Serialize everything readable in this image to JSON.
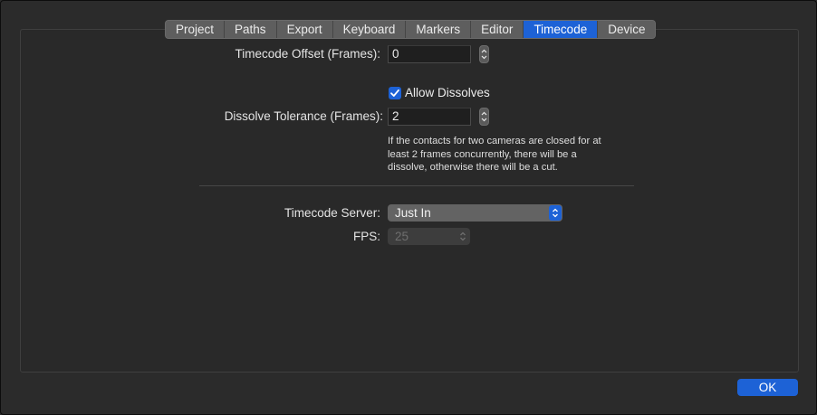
{
  "tabs": [
    {
      "label": "Project",
      "active": false
    },
    {
      "label": "Paths",
      "active": false
    },
    {
      "label": "Export",
      "active": false
    },
    {
      "label": "Keyboard",
      "active": false
    },
    {
      "label": "Markers",
      "active": false
    },
    {
      "label": "Editor",
      "active": false
    },
    {
      "label": "Timecode",
      "active": true
    },
    {
      "label": "Device",
      "active": false
    }
  ],
  "timecode_offset": {
    "label": "Timecode Offset (Frames):",
    "value": "0"
  },
  "allow_dissolves": {
    "label": "Allow Dissolves",
    "checked": true
  },
  "dissolve_tolerance": {
    "label": "Dissolve Tolerance (Frames):",
    "value": "2"
  },
  "help_text": "If the contacts for two cameras are closed for at least 2 frames concurrently, there will be a dissolve, otherwise there will be a cut.",
  "timecode_server": {
    "label": "Timecode Server:",
    "value": "Just In"
  },
  "fps": {
    "label": "FPS:",
    "value": "25",
    "enabled": false
  },
  "ok_label": "OK",
  "colors": {
    "accent": "#1d62d6",
    "background": "#2b2b2b"
  },
  "icons": {
    "stepper": "stepper-icon",
    "checkmark": "checkmark-icon",
    "popup_arrows": "updown-chevron-icon"
  }
}
